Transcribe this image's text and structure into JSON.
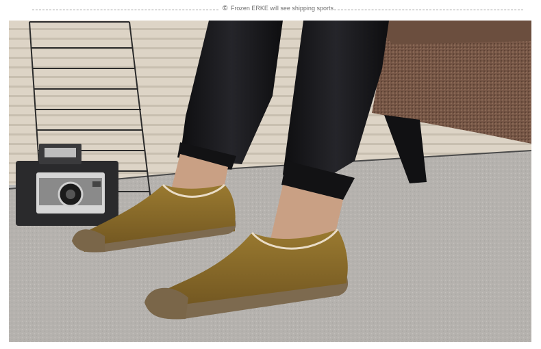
{
  "banner": {
    "copyright_symbol": "©",
    "caption": "Frozen  ERKE will see shipping sports"
  },
  "photo": {
    "subject": "photo",
    "colors": {
      "blind": "#dcd3c4",
      "carpet": "#b6b3b0",
      "sofa": "#7a5b48",
      "trousers": "#17171a",
      "shoe_suede": "#8a6a28",
      "shoe_sole": "#7c6a4e",
      "skin": "#c9a084"
    }
  }
}
